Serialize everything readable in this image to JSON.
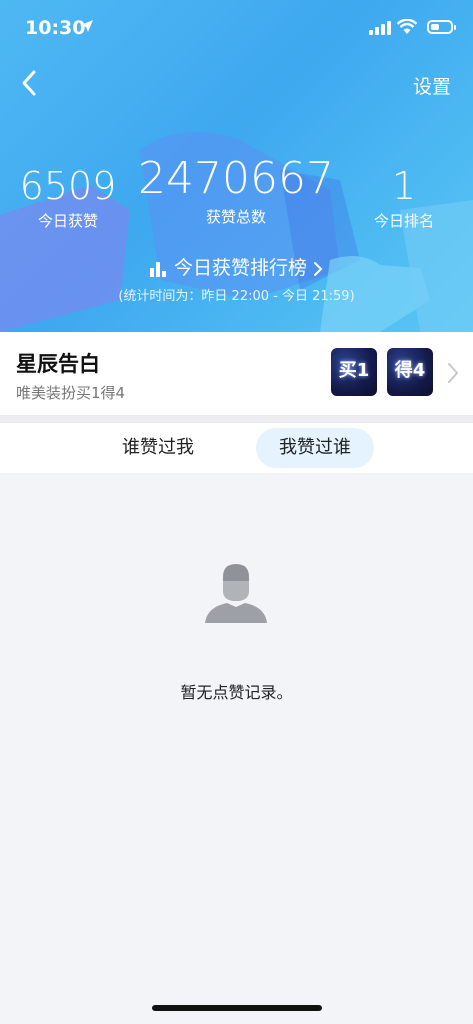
{
  "status_bar": {
    "time": "10:30"
  },
  "header": {
    "settings_label": "设置"
  },
  "stats": {
    "today_likes": {
      "value": "6509",
      "label": "今日获赞"
    },
    "total_likes": {
      "value": "2470667",
      "label": "获赞总数"
    },
    "today_rank": {
      "value": "1",
      "label": "今日排名"
    }
  },
  "ranking_link": {
    "label": "今日获赞排行榜"
  },
  "period_note": "(统计时间为：昨日 22:00 - 今日 21:59)",
  "promo": {
    "title": "星辰告白",
    "subtitle": "唯美装扮买1得4",
    "badges": [
      "买1",
      "得4"
    ]
  },
  "tabs": [
    {
      "label": "谁赞过我",
      "active": false
    },
    {
      "label": "我赞过谁",
      "active": true
    }
  ],
  "empty_state": {
    "message": "暂无点赞记录。"
  },
  "colors": {
    "hero": "#3ea8f0",
    "active_tab_bg": "#e4f3fd"
  }
}
